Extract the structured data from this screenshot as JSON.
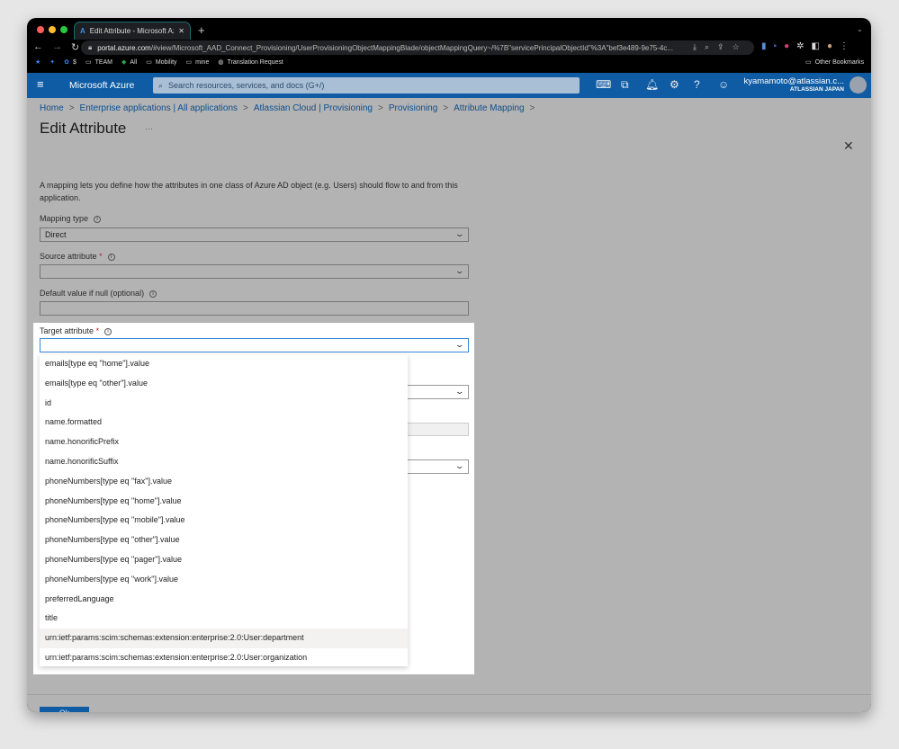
{
  "browser": {
    "tab_title": "Edit Attribute - Microsoft Azure",
    "url_domain": "portal.azure.com",
    "url_path": "/#view/Microsoft_AAD_Connect_Provisioning/UserProvisioningObjectMappingBlade/objectMappingQuery~/%7B\"servicePrincipalObjectId\"%3A\"bef3e489-9e75-4c...",
    "bookmarks": [
      "$",
      "TEAM",
      "All",
      "Mobility",
      "mine",
      "Translation Request"
    ],
    "other_bookmarks": "Other Bookmarks"
  },
  "azure": {
    "brand": "Microsoft Azure",
    "search_placeholder": "Search resources, services, and docs (G+/)",
    "user_email": "kyamamoto@atlassian.c...",
    "user_org": "ATLASSIAN JAPAN"
  },
  "breadcrumb": [
    "Home",
    "Enterprise applications | All applications",
    "Atlassian Cloud | Provisioning",
    "Provisioning",
    "Attribute Mapping"
  ],
  "page": {
    "title": "Edit Attribute",
    "more": "···",
    "description": "A mapping lets you define how the attributes in one class of Azure AD object (e.g. Users) should flow to and from this application.",
    "mapping_type_label": "Mapping type",
    "mapping_type_value": "Direct",
    "source_attribute_label": "Source attribute",
    "default_value_label": "Default value if null (optional)",
    "target_attribute_label": "Target attribute",
    "required_mark": "*",
    "ok_label": "Ok"
  },
  "dropdown_options": [
    "emails[type eq \"home\"].value",
    "emails[type eq \"other\"].value",
    "id",
    "name.formatted",
    "name.honorificPrefix",
    "name.honorificSuffix",
    "phoneNumbers[type eq \"fax\"].value",
    "phoneNumbers[type eq \"home\"].value",
    "phoneNumbers[type eq \"mobile\"].value",
    "phoneNumbers[type eq \"other\"].value",
    "phoneNumbers[type eq \"pager\"].value",
    "phoneNumbers[type eq \"work\"].value",
    "preferredLanguage",
    "title",
    "urn:ietf:params:scim:schemas:extension:enterprise:2.0:User:department",
    "urn:ietf:params:scim:schemas:extension:enterprise:2.0:User:organization"
  ],
  "hovered_option_index": 14
}
